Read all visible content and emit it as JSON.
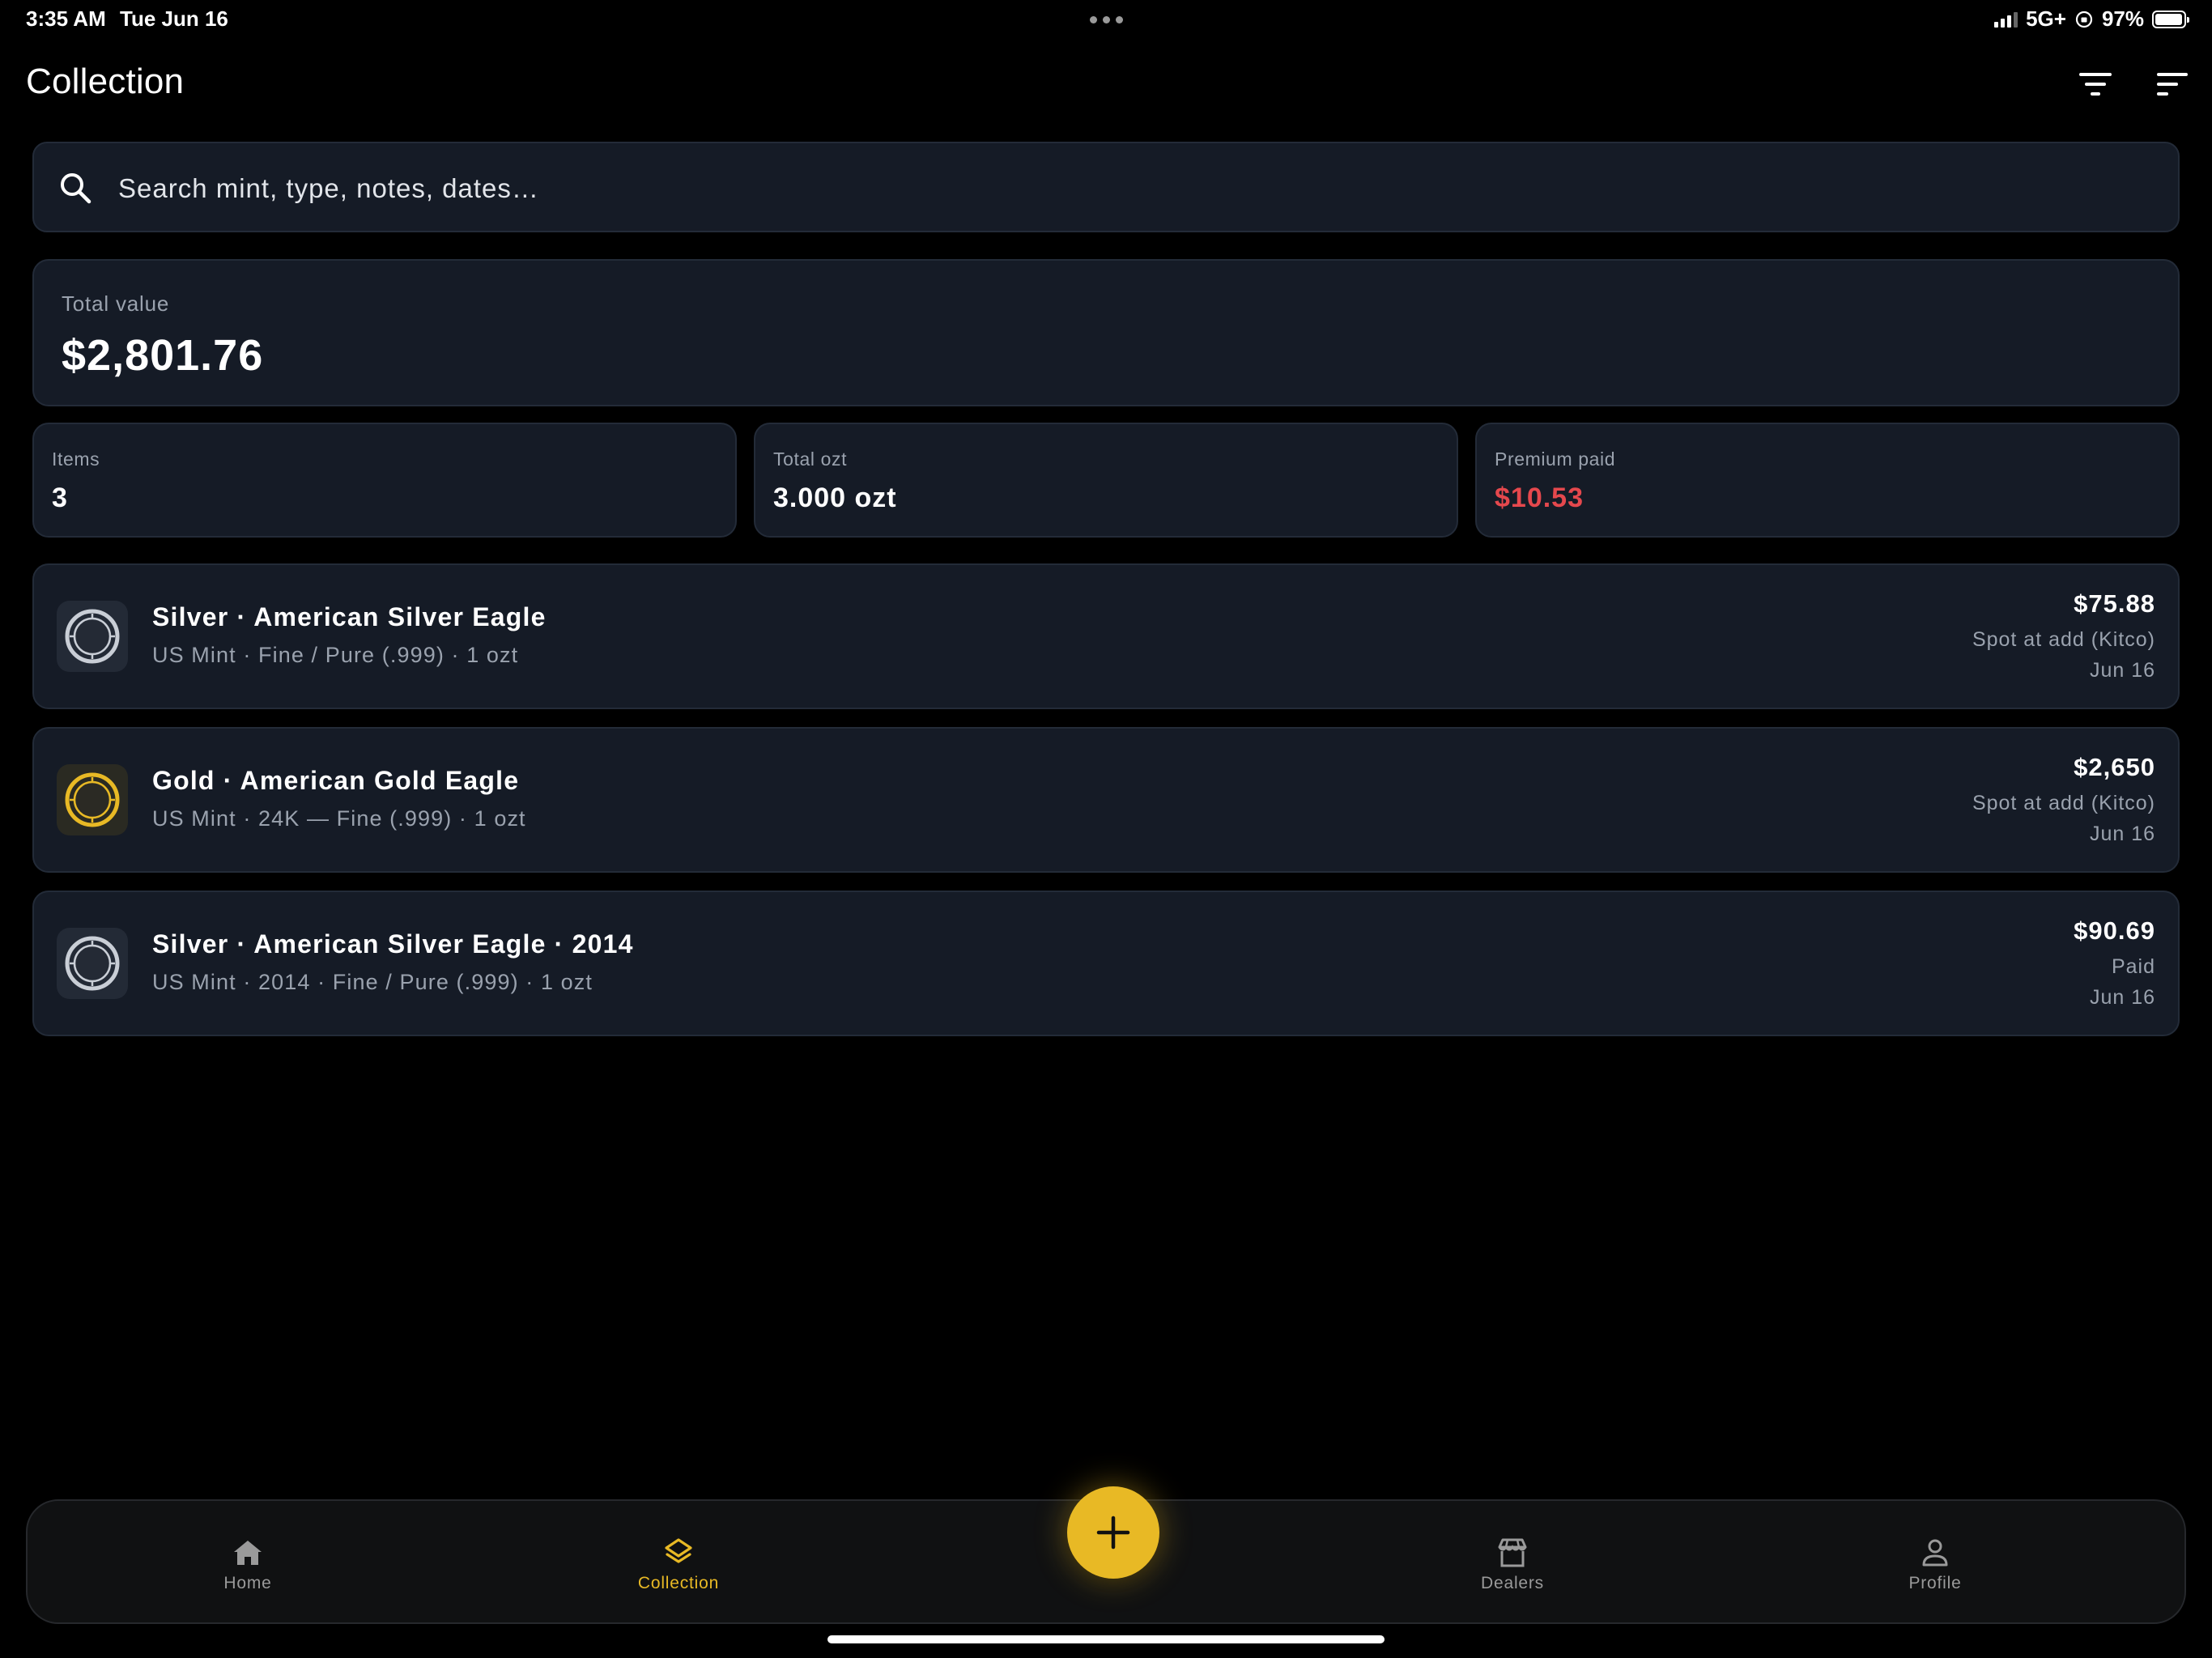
{
  "status_bar": {
    "time": "3:35 AM",
    "date": "Tue Jun 16",
    "network": "5G+",
    "battery": "97%"
  },
  "header": {
    "title": "Collection",
    "filter_icon": "filter-icon",
    "sort_icon": "sort-icon"
  },
  "search": {
    "placeholder": "Search mint, type, notes, dates…",
    "value": ""
  },
  "summary": {
    "total_label": "Total value",
    "total_value": "$2,801.76",
    "stats": [
      {
        "label": "Items",
        "value": "3"
      },
      {
        "label": "Total ozt",
        "value": "3.000 ozt"
      },
      {
        "label": "Premium paid",
        "value": "$10.53"
      }
    ]
  },
  "items": [
    {
      "metal": "silver",
      "title": "Silver · American Silver Eagle",
      "details": "US Mint · Fine / Pure (.999) · 1 ozt",
      "price": "$75.88",
      "basis": "Spot at add (Kitco)",
      "date": "Jun 16"
    },
    {
      "metal": "gold",
      "title": "Gold · American Gold Eagle",
      "details": "US Mint · 24K — Fine (.999) · 1 ozt",
      "price": "$2,650",
      "basis": "Spot at add (Kitco)",
      "date": "Jun 16"
    },
    {
      "metal": "silver",
      "title": "Silver · American Silver Eagle · 2014",
      "details": "US Mint · 2014 · Fine / Pure (.999) · 1 ozt",
      "price": "$90.69",
      "basis": "Paid",
      "date": "Jun 16"
    }
  ],
  "nav": {
    "items": [
      {
        "label": "Home",
        "icon": "home-icon"
      },
      {
        "label": "Collection",
        "icon": "layers-icon"
      },
      {
        "label": "Dealers",
        "icon": "store-icon"
      },
      {
        "label": "Profile",
        "icon": "person-icon"
      }
    ],
    "add_icon": "plus-icon"
  },
  "colors": {
    "accent": "#e8b925",
    "negative": "#e5484d",
    "card_bg": "#151b26",
    "background": "#000000",
    "muted_text": "#9aa2ae",
    "silver": "#c9ced6",
    "gold": "#e8b925"
  }
}
